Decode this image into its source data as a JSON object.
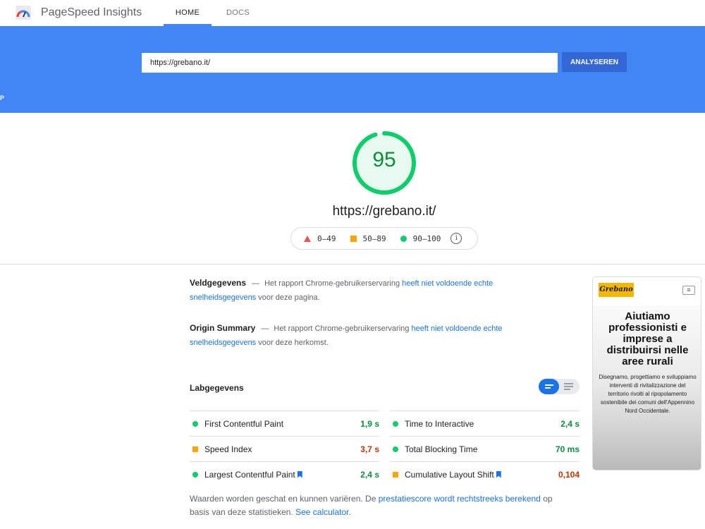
{
  "app": {
    "title": "PageSpeed Insights"
  },
  "nav": {
    "tabs": [
      {
        "label": "HOME"
      },
      {
        "label": "DOCS"
      }
    ]
  },
  "search": {
    "value": "https://grebano.it/",
    "button_label": "ANALYSEREN"
  },
  "hero_edge_text": "P",
  "score": {
    "value": "95",
    "color": "#0cce6b"
  },
  "tested_url": "https://grebano.it/",
  "legend": {
    "items": [
      {
        "label": "0–49",
        "color": "#ef5350"
      },
      {
        "label": "50–89",
        "color": "#ffa400"
      },
      {
        "label": "90–100",
        "color": "#0cce6b"
      }
    ],
    "info_icon": "info-icon"
  },
  "field_data": {
    "title": "Veldgegevens",
    "dash": "—",
    "text_before": "Het rapport Chrome-gebruikerservaring",
    "link": "heeft niet voldoende echte snelheidsgegevens",
    "text_after": "voor deze pagina."
  },
  "origin_summary": {
    "title": "Origin Summary",
    "dash": "—",
    "text_before": "Het rapport Chrome-gebruikerservaring",
    "link": "heeft niet voldoende echte snelheidsgegevens",
    "text_after": "voor deze herkomst."
  },
  "lab_data": {
    "title": "Labgegevens",
    "metrics": [
      {
        "label": "First Contentful Paint",
        "value": "1,9 s",
        "status": "green"
      },
      {
        "label": "Time to Interactive",
        "value": "2,4 s",
        "status": "green"
      },
      {
        "label": "Speed Index",
        "value": "3,7 s",
        "status": "orange"
      },
      {
        "label": "Total Blocking Time",
        "value": "70 ms",
        "status": "green"
      },
      {
        "label": "Largest Contentful Paint",
        "value": "2,4 s",
        "status": "green",
        "bookmark": true
      },
      {
        "label": "Cumulative Layout Shift",
        "value": "0,104",
        "status": "orange",
        "bookmark": true
      }
    ]
  },
  "footnote": {
    "text1": "Waarden worden geschat en kunnen variëren. De",
    "link1": "prestatiescore wordt rechtstreeks berekend",
    "text2": "op basis van deze statistieken.",
    "link2": "See calculator."
  },
  "thumbnail": {
    "logo": "Grebano",
    "menu_icon": "menu-icon",
    "headline": "Aiutiamo professionisti e imprese a distribuirsi nelle aree rurali",
    "body": "Disegnamo, progettiamo e sviluppiamo interventi di rivitalizzazione del territorio rivolti al ripopolamento sostenibile dei comuni dell'Appennino Nord Occidentale."
  }
}
